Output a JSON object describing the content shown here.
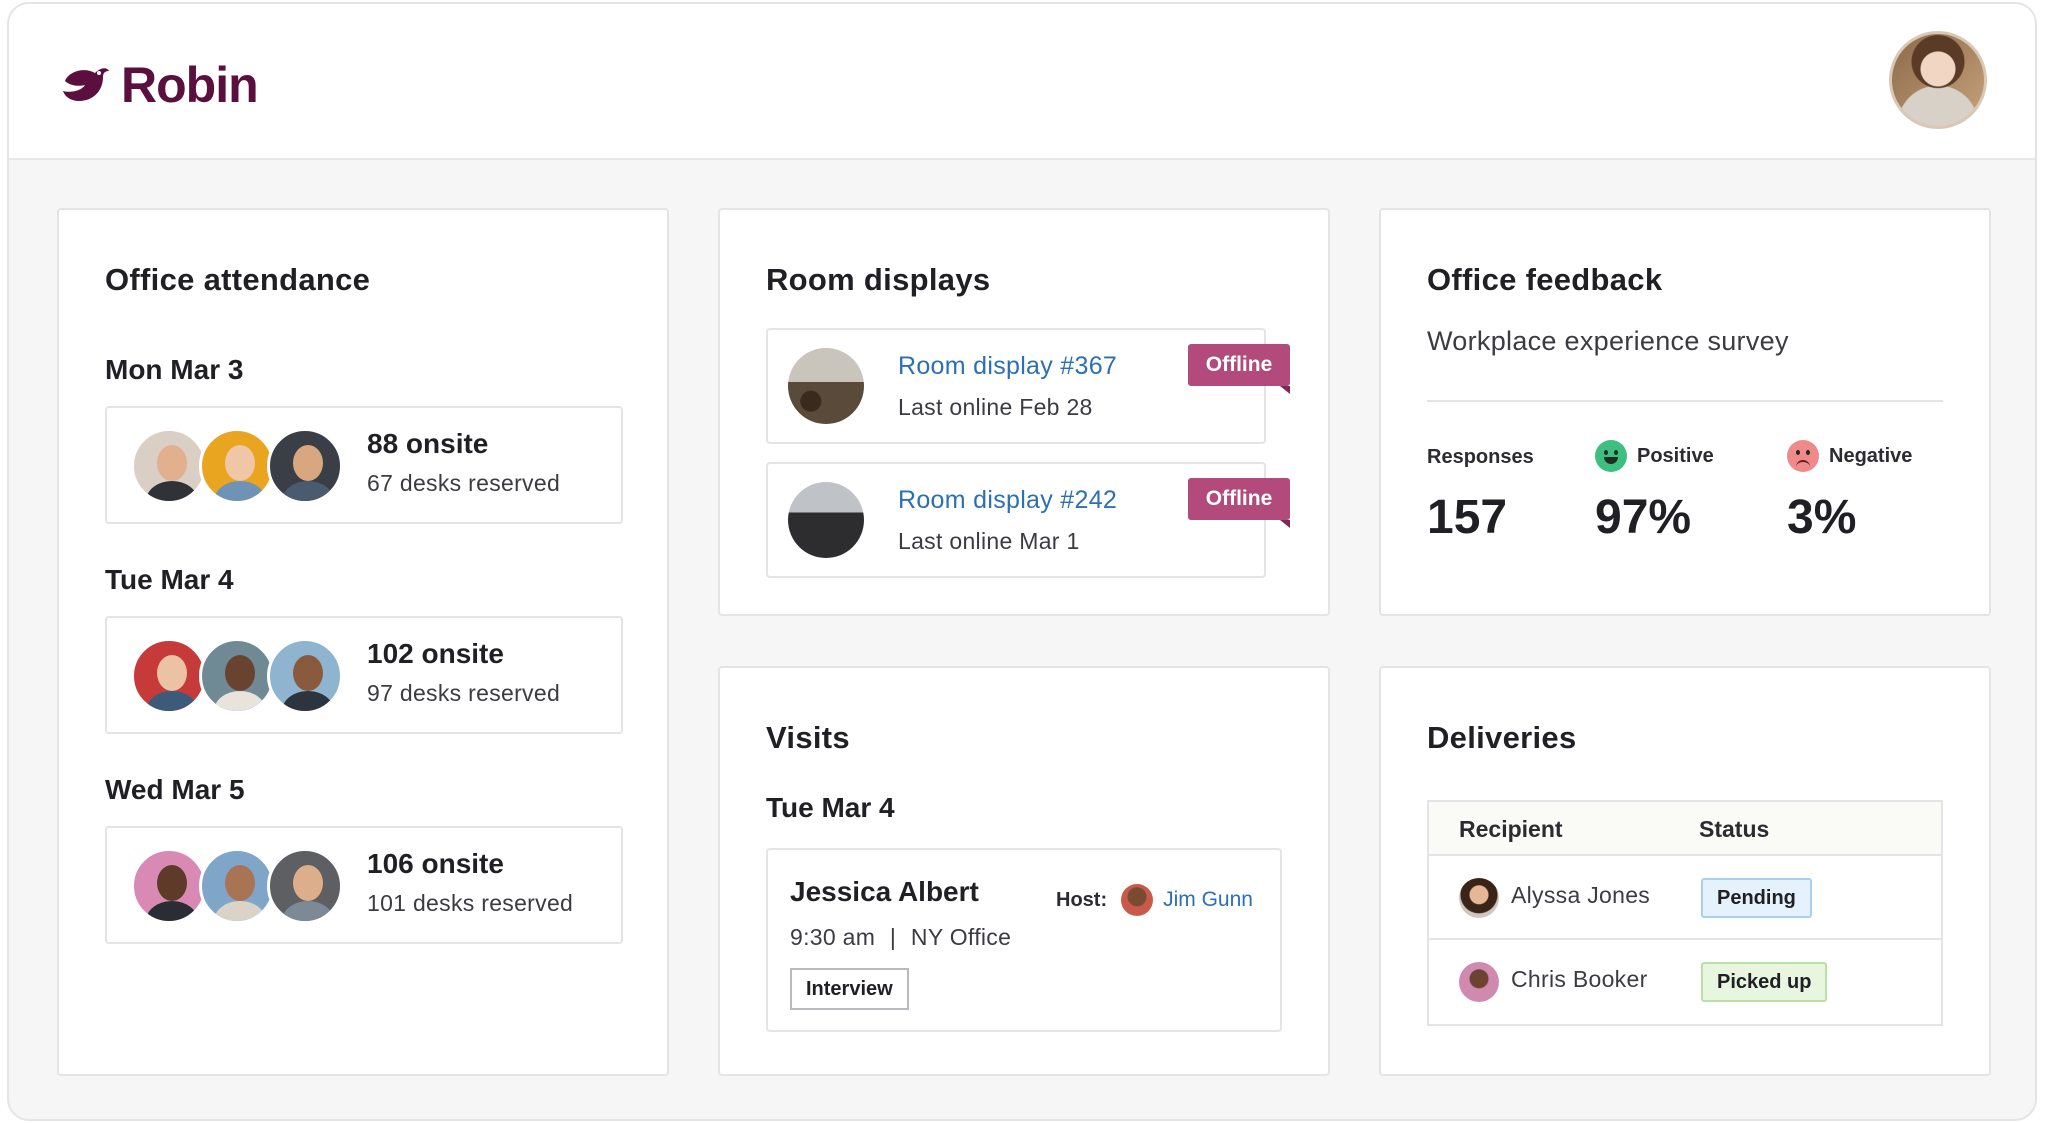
{
  "app": {
    "name": "Robin"
  },
  "attendance": {
    "title": "Office attendance",
    "days": [
      {
        "label": "Mon Mar 3",
        "onsite": "88 onsite",
        "desks": "67 desks reserved"
      },
      {
        "label": "Tue Mar 4",
        "onsite": "102 onsite",
        "desks": "97 desks reserved"
      },
      {
        "label": "Wed Mar 5",
        "onsite": "106 onsite",
        "desks": "101 desks reserved"
      }
    ]
  },
  "room_displays": {
    "title": "Room displays",
    "items": [
      {
        "name": "Room display #367",
        "last_online": "Last online Feb 28",
        "status": "Offline"
      },
      {
        "name": "Room display #242",
        "last_online": "Last online Mar 1",
        "status": "Offline"
      }
    ]
  },
  "feedback": {
    "title": "Office feedback",
    "subtitle": "Workplace experience survey",
    "responses_label": "Responses",
    "responses_value": "157",
    "positive_label": "Positive",
    "positive_value": "97%",
    "negative_label": "Negative",
    "negative_value": "3%"
  },
  "visits": {
    "title": "Visits",
    "day": "Tue Mar 4",
    "visitor": "Jessica Albert",
    "host_label": "Host:",
    "host_name": "Jim Gunn",
    "time": "9:30 am",
    "separator": "|",
    "location": "NY Office",
    "tag": "Interview"
  },
  "deliveries": {
    "title": "Deliveries",
    "col_recipient": "Recipient",
    "col_status": "Status",
    "rows": [
      {
        "recipient": "Alyssa Jones",
        "status": "Pending"
      },
      {
        "recipient": "Chris Booker",
        "status": "Picked up"
      }
    ]
  },
  "colors": {
    "brand": "#5b0f3e",
    "offline_badge": "#b24a7c",
    "link": "#2d6fb4"
  }
}
